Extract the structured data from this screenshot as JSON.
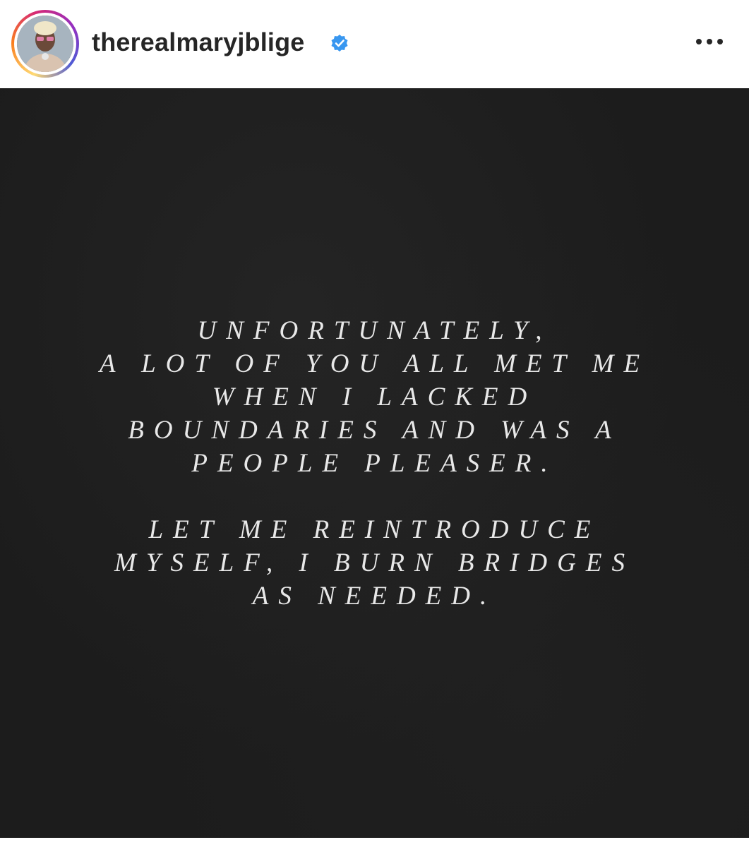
{
  "post": {
    "username": "therealmaryjblige",
    "verified": true,
    "avatar_icon": "profile-avatar",
    "more_icon": "more-options-icon"
  },
  "image_text": {
    "paragraph1": [
      "UNFORTUNATELY,",
      "A LOT OF YOU ALL MET ME",
      "WHEN I LACKED",
      "BOUNDARIES AND WAS A",
      "PEOPLE PLEASER."
    ],
    "paragraph2": [
      "LET ME REINTRODUCE",
      "MYSELF, I BURN BRIDGES",
      "AS NEEDED."
    ]
  },
  "colors": {
    "verified_badge": "#3897f0",
    "image_background": "#1c1c1c",
    "quote_text": "#e8e8e8"
  }
}
